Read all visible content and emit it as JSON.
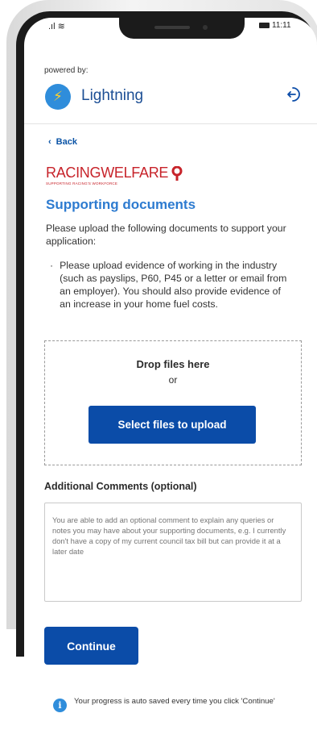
{
  "status_bar": {
    "signal": ".ıl ≋",
    "time": "11:11"
  },
  "header": {
    "powered_by": "powered by:",
    "brand": "Lightning"
  },
  "nav": {
    "back_label": "Back"
  },
  "org": {
    "name": "RACINGWELFARE",
    "tagline": "SUPPORTING RACING'S WORKFORCE"
  },
  "page": {
    "title": "Supporting documents",
    "intro": "Please upload the following documents to support your application:",
    "requirements": [
      "Please upload evidence of working in the industry (such as payslips, P60, P45 or a letter or email from an employer). You should also provide evidence of an increase in your home fuel costs."
    ]
  },
  "upload": {
    "drop_title": "Drop files here",
    "drop_or": "or",
    "button_label": "Select files to upload"
  },
  "comments": {
    "label": "Additional Comments (optional)",
    "placeholder": "You are able to add an optional comment to explain any queries or notes you may have about your supporting documents, e.g. I currently don't have a copy of my current council tax bill but can provide it at a later date",
    "value": ""
  },
  "actions": {
    "continue_label": "Continue"
  },
  "info": {
    "autosave_text": "Your progress is auto saved every time you click 'Continue'"
  },
  "colors": {
    "primary": "#0b4ca8",
    "title": "#2d7bd0",
    "brand_red": "#c7232a",
    "info_blue": "#2f8ddb"
  }
}
